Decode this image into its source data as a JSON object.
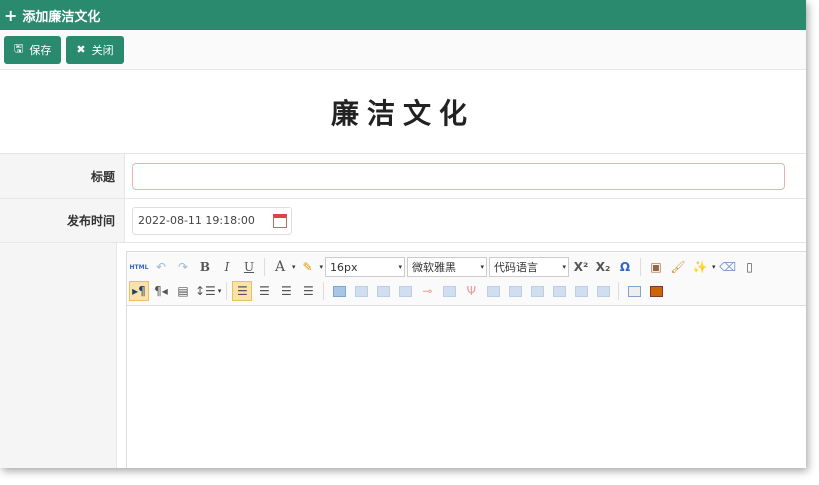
{
  "window": {
    "title": "添加廉洁文化"
  },
  "toolbar": {
    "save_label": "保存",
    "close_label": "关闭"
  },
  "page": {
    "heading": "廉洁文化"
  },
  "form": {
    "title_label": "标题",
    "title_value": "",
    "date_label": "发布时间",
    "date_value": "2022-08-11 19:18:00"
  },
  "editor": {
    "html_label": "HTML",
    "font_size": "16px",
    "font_family": "微软雅黑",
    "code_language": "代码语言",
    "bold": "B",
    "italic": "I",
    "underline": "U",
    "font_color": "A",
    "omega": "Ω"
  },
  "colors": {
    "accent": "#2a8a6e"
  }
}
